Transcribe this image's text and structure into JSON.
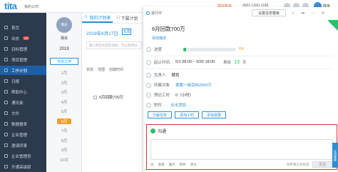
{
  "topbar": {
    "logo": "tita",
    "company": "我的公司",
    "trial": "现在购买",
    "phone": "4001-1360-1188",
    "user": "魏良"
  },
  "sidebar": {
    "items": [
      {
        "label": "首页",
        "badge": ""
      },
      {
        "label": "动态",
        "badge": "43"
      },
      {
        "label": "目标管理",
        "badge": ""
      },
      {
        "label": "项目管理",
        "badge": ""
      },
      {
        "label": "工作计划",
        "badge": "",
        "active": true
      },
      {
        "label": "日报",
        "badge": ""
      },
      {
        "label": "帮助中心",
        "badge": ""
      },
      {
        "label": "通讯录",
        "badge": ""
      },
      {
        "label": "文件",
        "badge": ""
      },
      {
        "label": "数据报表",
        "badge": ""
      },
      {
        "label": "企业管理",
        "badge": ""
      },
      {
        "label": "邀请同事",
        "badge": ""
      },
      {
        "label": "企业管理员",
        "badge": ""
      },
      {
        "label": "开通高级版",
        "badge": ""
      }
    ]
  },
  "midcol": {
    "avatar_label": "魏良",
    "name": "魏良",
    "year": "2019",
    "today": "今日工作",
    "months": [
      "1月",
      "2月",
      "3月",
      "4月",
      "5月",
      "6月",
      "7月",
      "8月",
      "9月",
      "10月"
    ],
    "selected_month": "6月"
  },
  "list": {
    "tabs": [
      "我的计划表",
      "下属计划"
    ],
    "date": "2019年6月17日",
    "date_btn": "本周",
    "input_placeholder": "输入新任务回车添加，可以使用@...",
    "filters": [
      "状态",
      "范围",
      "创建时间"
    ],
    "task": "6月回款700万"
  },
  "detail": {
    "status": "进行中",
    "set_template": "设置任务模板",
    "title": "6月回款700万",
    "desc_link": "添加描述",
    "progress_label": "进度",
    "progress_value": "6%",
    "progress": 0.06,
    "date_label": "起止时间",
    "date_range": "6/1 08:00 ~ 6/30 18:00",
    "remain_label": "剩余",
    "remain_num": "13",
    "remain_unit": "天",
    "owner_label": "负责人",
    "owner": "魏良",
    "belong_label": "所属对象",
    "belong": "隶属一级目标2000万",
    "hours_label": "预估工时",
    "hours": "0（小时）",
    "attach_label": "附件",
    "attach_link": "点击添加",
    "buttons": [
      "分解任务",
      "添加工时",
      "添加进展"
    ]
  },
  "comment": {
    "title": "沟通",
    "tools": [
      "@",
      "表情",
      "图片",
      "附件",
      "评价"
    ],
    "check_label": "同步到工作日志",
    "send": "发送"
  },
  "sidetab": "在线客服"
}
